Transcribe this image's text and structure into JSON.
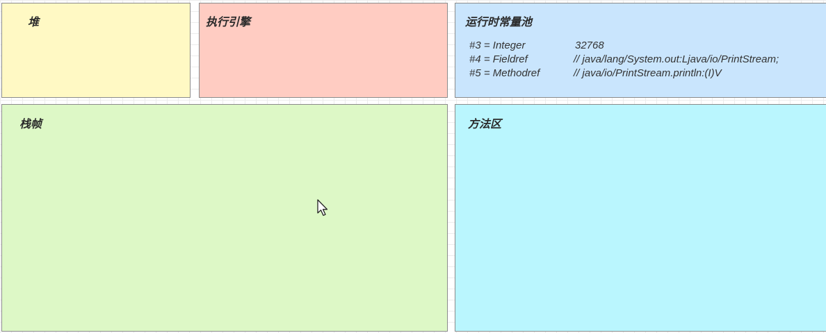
{
  "panels": {
    "heap": {
      "title": "堆"
    },
    "execution_engine": {
      "title": "执行引擎"
    },
    "runtime_constant_pool": {
      "title": "运行时常量池",
      "entries": [
        {
          "ref": "#3 = Integer",
          "value": "32768"
        },
        {
          "ref": "#4 = Fieldref",
          "value": "// java/lang/System.out:Ljava/io/PrintStream;"
        },
        {
          "ref": "#5 = Methodref",
          "value": "// java/io/PrintStream.println:(I)V"
        }
      ]
    },
    "stack_frame": {
      "title": "栈帧"
    },
    "method_area": {
      "title": "方法区"
    }
  },
  "colors": {
    "heap": "#fff9c4",
    "execution_engine": "#ffccc2",
    "runtime_constant_pool": "#c9e5fd",
    "stack_frame": "#ddf8c6",
    "method_area": "#baf6fe"
  },
  "cursor_icon": "arrow-pointer-icon"
}
